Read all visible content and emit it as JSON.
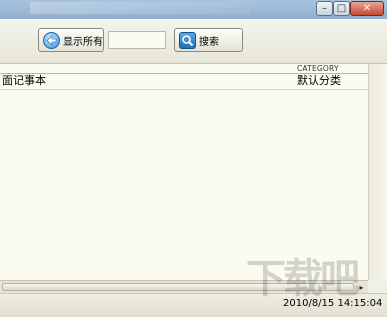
{
  "window": {
    "minimize_glyph": "–",
    "maximize_glyph": "□",
    "close_glyph": "✕"
  },
  "toolbar": {
    "show_all_label": "显示所有",
    "search_input_value": "",
    "search_label": "搜索"
  },
  "list": {
    "category_header": "CATEGORY",
    "rows": [
      {
        "title": "面记事本",
        "category": "默认分类"
      }
    ]
  },
  "scroll": {
    "right_arrow": "▸"
  },
  "status": {
    "timestamp": "2010/8/15 14:15:04"
  },
  "watermark": {
    "text": "下载吧"
  }
}
